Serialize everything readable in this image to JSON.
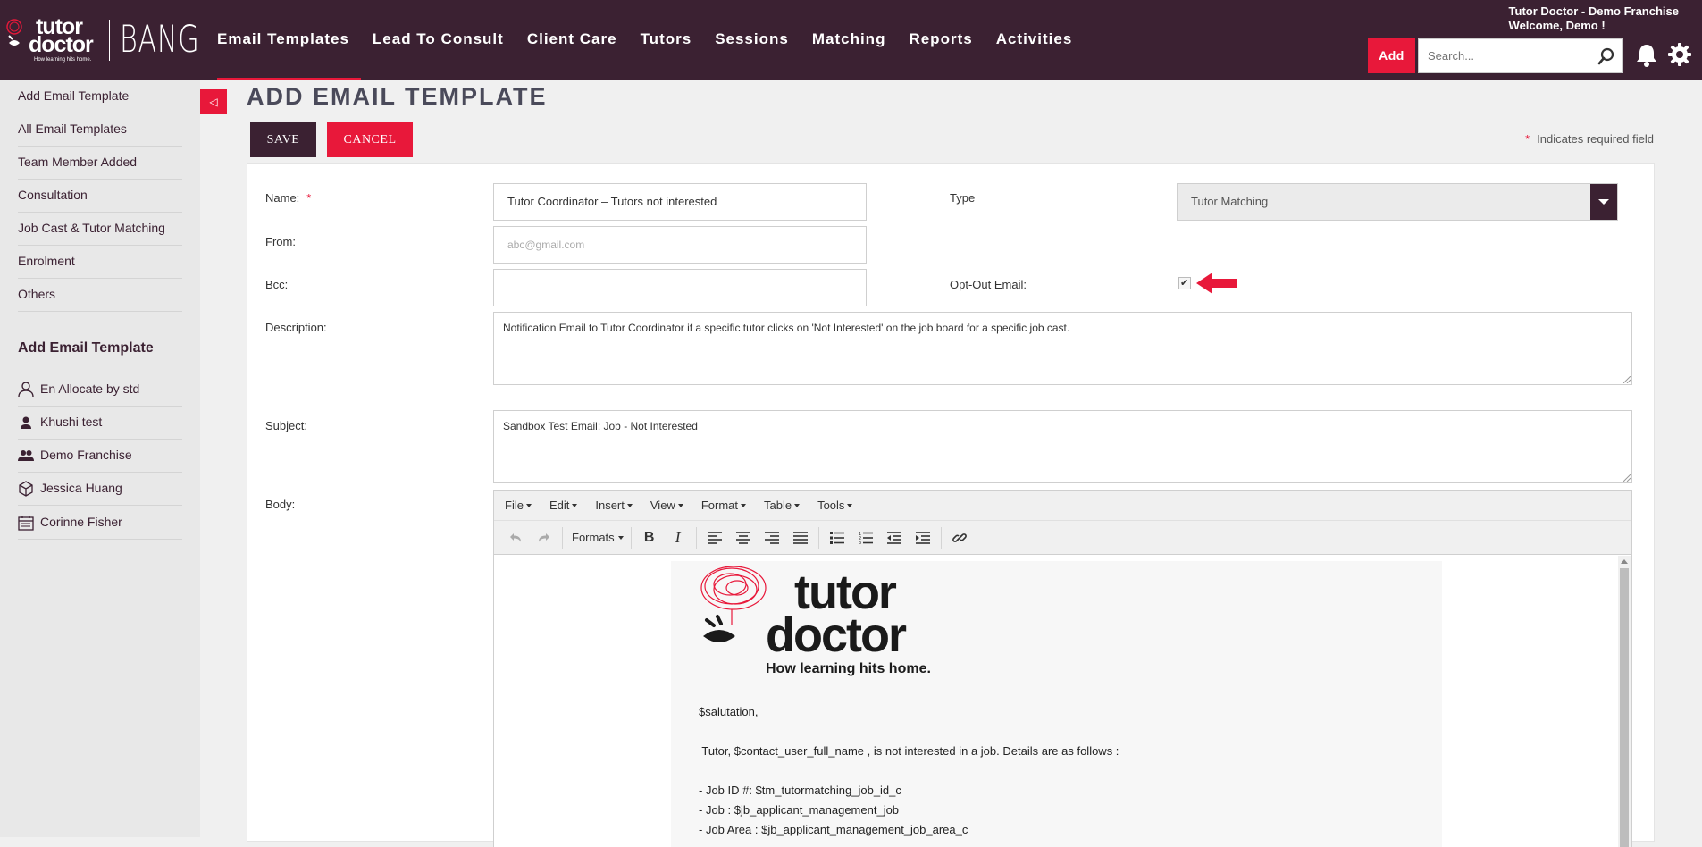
{
  "header": {
    "logo_line1": "tutor",
    "logo_line2": "doctor",
    "logo_tagline": "How learning hits home.",
    "brand": "BANG",
    "nav": [
      "Email Templates",
      "Lead To Consult",
      "Client Care",
      "Tutors",
      "Sessions",
      "Matching",
      "Reports",
      "Activities"
    ],
    "active_nav": "Email Templates",
    "franchise": "Tutor Doctor - Demo Franchise",
    "welcome": "Welcome, Demo !",
    "add_label": "Add",
    "search_placeholder": "Search..."
  },
  "sidebar": {
    "items": [
      "Add Email Template",
      "All Email Templates",
      "Team Member Added",
      "Consultation",
      "Job Cast & Tutor Matching",
      "Enrolment",
      "Others"
    ],
    "section_title": "Add Email Template",
    "users": [
      {
        "name": "En Allocate by std",
        "icon": "user-outline-icon"
      },
      {
        "name": "Khushi test",
        "icon": "user-filled-icon"
      },
      {
        "name": "Demo Franchise",
        "icon": "users-group-icon"
      },
      {
        "name": "Jessica Huang",
        "icon": "cube-icon"
      },
      {
        "name": "Corinne Fisher",
        "icon": "calendar-icon"
      }
    ]
  },
  "page": {
    "collapse_glyph": "◁",
    "title": "ADD EMAIL TEMPLATE",
    "save_label": "SAVE",
    "cancel_label": "CANCEL",
    "required_star": "*",
    "required_note": "Indicates required field"
  },
  "form": {
    "name_label": "Name:",
    "name_value": "Tutor Coordinator – Tutors not interested",
    "from_label": "From:",
    "from_placeholder": "abc@gmail.com",
    "bcc_label": "Bcc:",
    "bcc_value": "",
    "type_label": "Type",
    "type_value": "Tutor Matching",
    "optout_label": "Opt-Out Email:",
    "optout_checked": true,
    "optout_glyph": "✔",
    "description_label": "Description:",
    "description_value": "Notification Email to Tutor Coordinator if a specific tutor clicks on 'Not Interested' on the job board for a specific job cast.",
    "subject_label": "Subject:",
    "subject_value": "Sandbox Test Email: Job - Not Interested",
    "body_label": "Body:"
  },
  "editor": {
    "menus": [
      "File",
      "Edit",
      "Insert",
      "View",
      "Format",
      "Table",
      "Tools"
    ],
    "formats_label": "Formats",
    "bold_glyph": "B",
    "italic_glyph": "I",
    "email_logo_line1": "tutor",
    "email_logo_line2": "doctor",
    "email_logo_tagline": "How learning hits home.",
    "lines": [
      "$salutation,",
      " Tutor, $contact_user_full_name , is not interested in a job. Details are as follows :",
      "- Job ID #: $tm_tutormatching_job_id_c",
      "- Job : $jb_applicant_management_job",
      "- Job Area : $jb_applicant_management_job_area_c"
    ]
  },
  "colors": {
    "header_bg": "#3b2132",
    "accent": "#e8183a",
    "sidebar_bg": "#e8e8e8"
  }
}
